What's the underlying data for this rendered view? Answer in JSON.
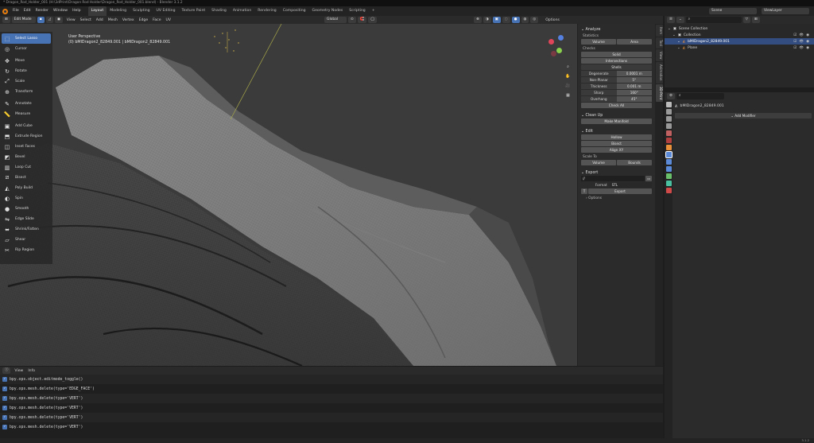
{
  "window": {
    "title": "* Dragon_Rod_Holder_001 (H:\\3dPrint\\Dragon Rod Holder\\Dragon_Rod_Holder_001.blend) - Blender 3.1.2"
  },
  "menubar": {
    "menus": [
      "File",
      "Edit",
      "Render",
      "Window",
      "Help"
    ],
    "workspaces": [
      "Layout",
      "Modeling",
      "Sculpting",
      "UV Editing",
      "Texture Paint",
      "Shading",
      "Animation",
      "Rendering",
      "Compositing",
      "Geometry Nodes",
      "Scripting"
    ],
    "active_workspace": "Layout",
    "add_tab": "+",
    "scene_label": "Scene",
    "view_layer_label": "ViewLayer"
  },
  "viewport_header": {
    "mode": "Edit Mode",
    "menus": [
      "View",
      "Select",
      "Add",
      "Mesh",
      "Vertex",
      "Edge",
      "Face",
      "UV"
    ],
    "transform_orientation": "Global",
    "options_label": "Options"
  },
  "viewport": {
    "perspective_label": "User Perspective",
    "object_label": "(0) bMIDragon2_82849.001 | bMIDragon2_82849.001"
  },
  "toolbar": {
    "tools": [
      {
        "label": "Select Lasso",
        "icon": "select-lasso-icon",
        "glyph": "⬚",
        "active": true
      },
      {
        "label": "Cursor",
        "icon": "cursor-icon",
        "glyph": "◎"
      },
      {
        "sep": true
      },
      {
        "label": "Move",
        "icon": "move-icon",
        "glyph": "✥"
      },
      {
        "label": "Rotate",
        "icon": "rotate-icon",
        "glyph": "↻"
      },
      {
        "label": "Scale",
        "icon": "scale-icon",
        "glyph": "⤢"
      },
      {
        "label": "Transform",
        "icon": "transform-icon",
        "glyph": "⊕"
      },
      {
        "sep": true
      },
      {
        "label": "Annotate",
        "icon": "annotate-icon",
        "glyph": "✎"
      },
      {
        "label": "Measure",
        "icon": "measure-icon",
        "glyph": "📏"
      },
      {
        "sep": true
      },
      {
        "label": "Add Cube",
        "icon": "add-cube-icon",
        "glyph": "▣"
      },
      {
        "label": "Extrude Region",
        "icon": "extrude-icon",
        "glyph": "⬒"
      },
      {
        "label": "Inset Faces",
        "icon": "inset-icon",
        "glyph": "◫"
      },
      {
        "label": "Bevel",
        "icon": "bevel-icon",
        "glyph": "◩"
      },
      {
        "label": "Loop Cut",
        "icon": "loop-cut-icon",
        "glyph": "▥"
      },
      {
        "label": "Bisect",
        "icon": "bisect-icon",
        "glyph": "⧄"
      },
      {
        "label": "Poly Build",
        "icon": "poly-build-icon",
        "glyph": "◭"
      },
      {
        "label": "Spin",
        "icon": "spin-icon",
        "glyph": "◐"
      },
      {
        "label": "Smooth",
        "icon": "smooth-icon",
        "glyph": "●"
      },
      {
        "label": "Edge Slide",
        "icon": "edge-slide-icon",
        "glyph": "⇋"
      },
      {
        "label": "Shrink/Fatten",
        "icon": "shrink-fatten-icon",
        "glyph": "⬌"
      },
      {
        "label": "Shear",
        "icon": "shear-icon",
        "glyph": "▱"
      },
      {
        "label": "Rip Region",
        "icon": "rip-region-icon",
        "glyph": "✂"
      }
    ]
  },
  "npanel": {
    "title": "Analyze",
    "statistics_label": "Statistics",
    "volume_btn": "Volume",
    "area_btn": "Area",
    "checks_label": "Checks",
    "solid_btn": "Solid",
    "intersections_btn": "Intersections",
    "sharp_sub": "Shells",
    "check_rows": [
      {
        "label": "Degenerate",
        "value": "0.0001 m"
      },
      {
        "label": "Non-Planar",
        "value": "5°"
      },
      {
        "label": "Thickness",
        "value": "0.001 m"
      },
      {
        "label": "Sharp",
        "value": "160°"
      },
      {
        "label": "Overhang",
        "value": "45°"
      }
    ],
    "check_all_btn": "Check All",
    "cleanup_title": "Clean Up",
    "make_manifold_btn": "Make Manifold",
    "edit_title": "Edit",
    "hollow_btn": "Hollow",
    "bisect_btn": "Bisect",
    "align_xy_btn": "Align XY",
    "scale_to_label": "Scale To",
    "scale_volume_btn": "Volume",
    "scale_bounds_btn": "Bounds",
    "export_title": "Export",
    "export_path": "//",
    "format_label": "Format",
    "format_value": "STL",
    "export_btn": "Export",
    "options_label": "Options",
    "side_tabs": [
      "Item",
      "Tool",
      "View",
      "Animation",
      "3D-Print"
    ],
    "active_side_tab": "3D-Print"
  },
  "info_editor": {
    "menus": [
      "View",
      "Info"
    ],
    "log": [
      "bpy.ops.object.editmode_toggle()",
      "bpy.ops.mesh.delete(type='EDGE_FACE')",
      "bpy.ops.mesh.delete(type='VERT')",
      "bpy.ops.mesh.delete(type='VERT')",
      "bpy.ops.mesh.delete(type='VERT')",
      "bpy.ops.mesh.delete(type='VERT')"
    ]
  },
  "outliner": {
    "search_placeholder": "",
    "rows": [
      {
        "label": "Scene Collection",
        "indent": 0,
        "icon": "scene-collection-icon"
      },
      {
        "label": "Collection",
        "indent": 1,
        "icon": "collection-icon"
      },
      {
        "label": "bMIDragon2_82849.001",
        "indent": 2,
        "icon": "mesh-icon",
        "selected": true
      },
      {
        "label": "Plane",
        "indent": 2,
        "icon": "mesh-icon"
      }
    ]
  },
  "properties": {
    "object_name": "bMIDragon2_82849.001",
    "add_modifier_btn": "Add Modifier"
  },
  "statusbar": {
    "version": "3.1.2"
  },
  "colors": {
    "accent": "#4772b3",
    "mesh_light": "#9a9a9a",
    "mesh_dark": "#4a4a4a",
    "selection": "#334d80"
  }
}
